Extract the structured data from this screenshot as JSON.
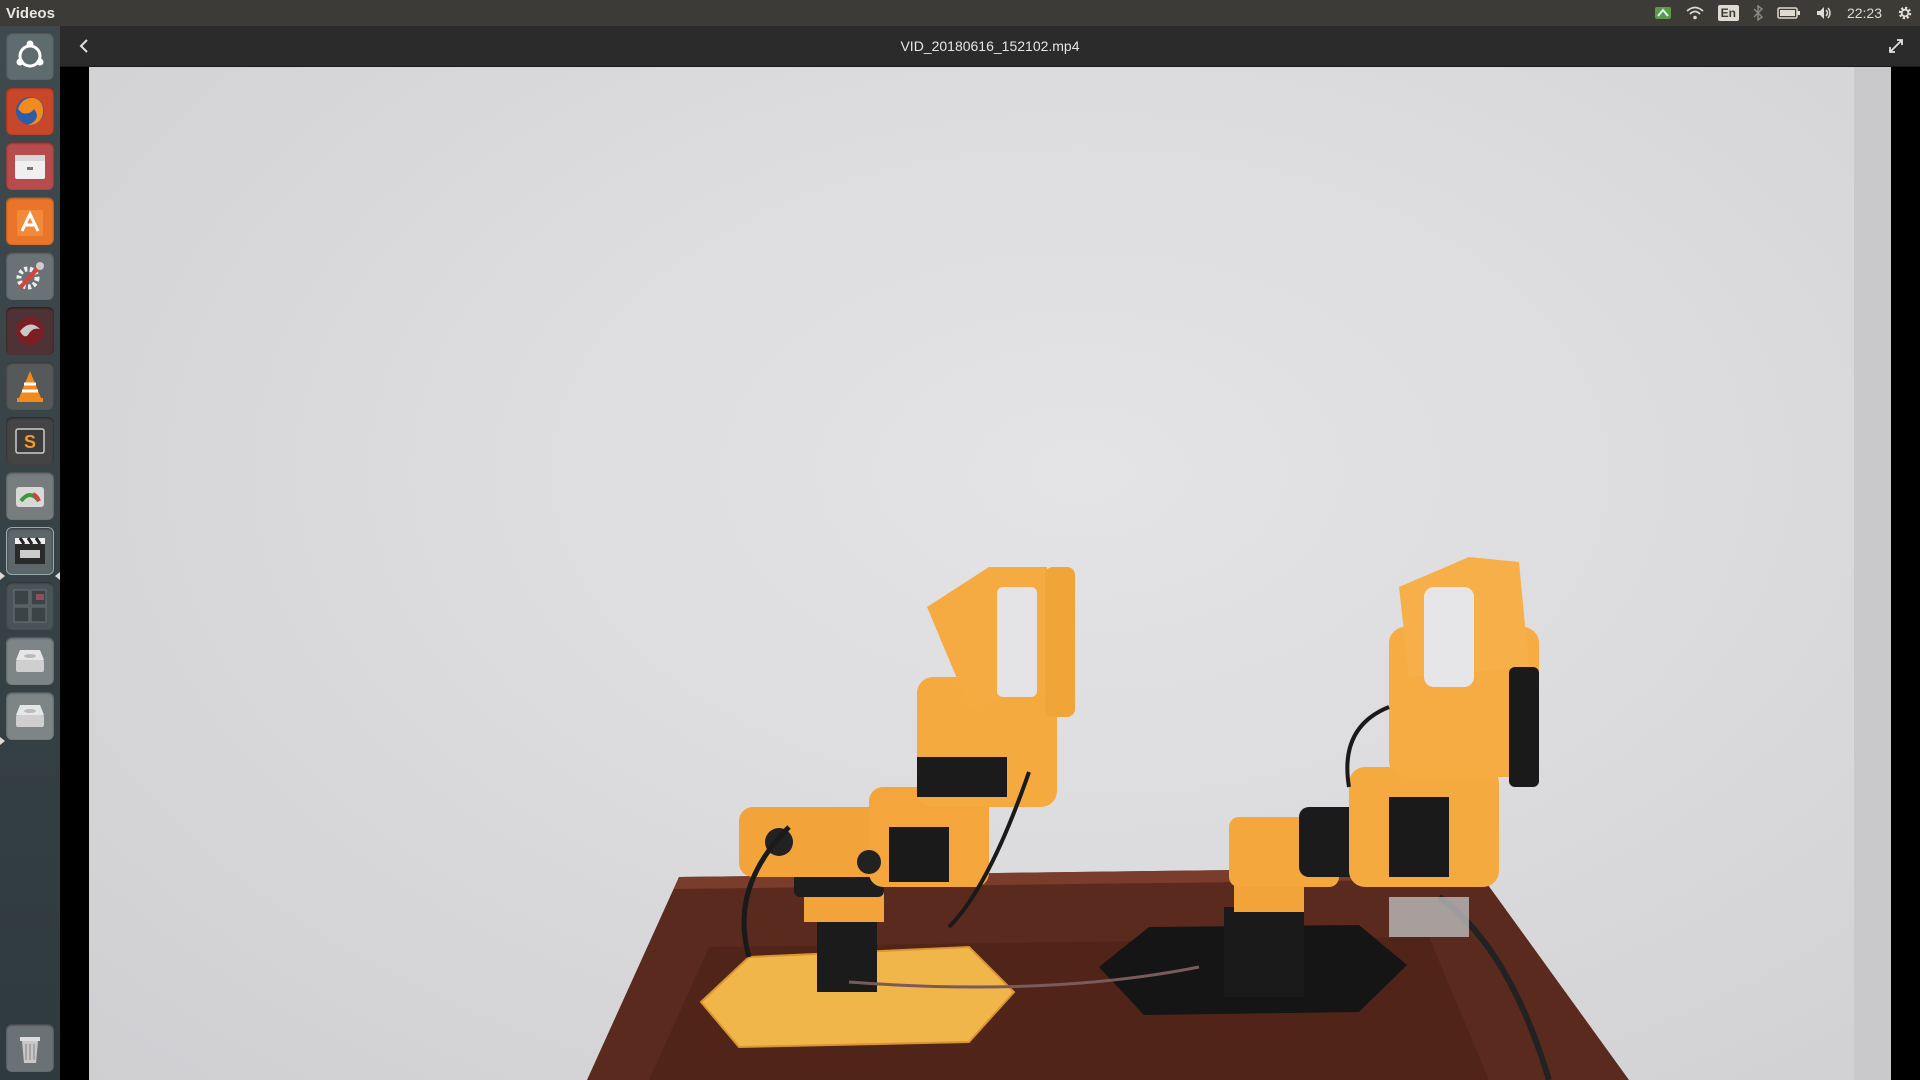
{
  "top_panel": {
    "app_name": "Videos",
    "keyboard_layout": "En",
    "clock": "22:23",
    "indicators": [
      "network-tray-icon",
      "wifi-icon",
      "keyboard-layout-icon",
      "bluetooth-icon",
      "battery-icon",
      "volume-icon",
      "clock",
      "settings-gear-icon"
    ]
  },
  "launcher": {
    "items": [
      {
        "name": "dash-home-icon"
      },
      {
        "name": "firefox-icon"
      },
      {
        "name": "files-icon"
      },
      {
        "name": "software-center-icon"
      },
      {
        "name": "system-settings-icon"
      },
      {
        "name": "monitor-app-icon"
      },
      {
        "name": "vlc-icon"
      },
      {
        "name": "sublime-text-icon"
      },
      {
        "name": "disk-usage-icon"
      },
      {
        "name": "videos-icon"
      },
      {
        "name": "workspace-switcher-icon"
      },
      {
        "name": "drive-icon"
      },
      {
        "name": "drive-icon-2"
      },
      {
        "name": "trash-icon"
      }
    ]
  },
  "header": {
    "title": "VID_20180616_152102.mp4"
  },
  "video": {
    "content": "video-frame"
  },
  "colors": {
    "panel": "#3c3b37",
    "launcher": "#36424a",
    "header": "#2b2b2b",
    "robot_orange": "#f2a33a"
  }
}
